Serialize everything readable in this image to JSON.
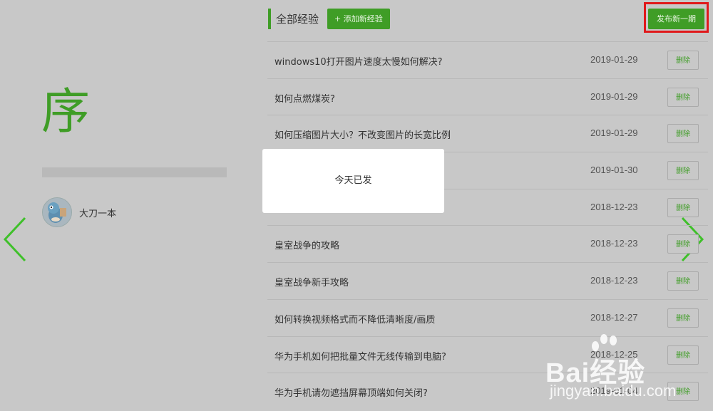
{
  "left_panel": {
    "big_char": "序",
    "user": {
      "name": "大刀一本"
    }
  },
  "nav": {
    "prev_icon": "chevron-left-icon",
    "next_icon": "chevron-right-icon"
  },
  "header": {
    "title": "全部经验",
    "add_label": "+ 添加新经验",
    "publish_label": "发布新一期"
  },
  "experiences": [
    {
      "title": "windows10打开图片速度太慢如何解决?",
      "date": "2019-01-29",
      "delete_label": "删除"
    },
    {
      "title": "如何点燃煤炭?",
      "date": "2019-01-29",
      "delete_label": "删除"
    },
    {
      "title": "如何压缩图片大小？不改变图片的长宽比例",
      "date": "2019-01-29",
      "delete_label": "删除"
    },
    {
      "title": "",
      "date": "2019-01-30",
      "delete_label": "删除"
    },
    {
      "title": "",
      "date": "2018-12-23",
      "delete_label": "删除"
    },
    {
      "title": "皇室战争的攻略",
      "date": "2018-12-23",
      "delete_label": "删除"
    },
    {
      "title": "皇室战争新手攻略",
      "date": "2018-12-23",
      "delete_label": "删除"
    },
    {
      "title": "如何转换视频格式而不降低清晰度/画质",
      "date": "2018-12-27",
      "delete_label": "删除"
    },
    {
      "title": "华为手机如何把批量文件无线传输到电脑?",
      "date": "2018-12-25",
      "delete_label": "删除"
    },
    {
      "title": "华为手机请勿遮挡屏幕顶端如何关闭?",
      "date": "2019-01-04",
      "delete_label": "删除"
    }
  ],
  "toast": {
    "message": "今天已发"
  },
  "watermark": {
    "brand": "Bai经验",
    "url": "jingyan.baidu.com"
  },
  "colors": {
    "accent": "#3f9d26",
    "highlight": "#e0191b",
    "background": "#c8c8c8"
  }
}
